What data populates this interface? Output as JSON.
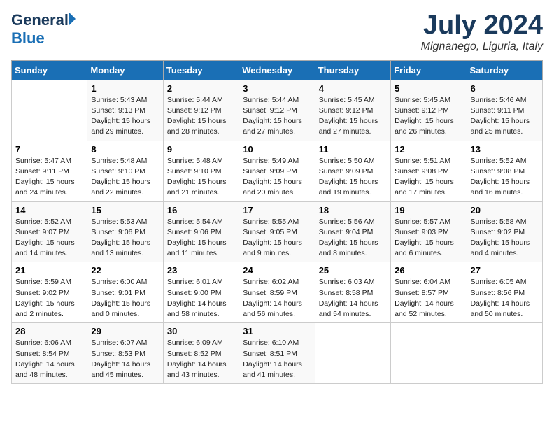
{
  "header": {
    "logo_general": "General",
    "logo_blue": "Blue",
    "month_year": "July 2024",
    "location": "Mignanego, Liguria, Italy"
  },
  "days_of_week": [
    "Sunday",
    "Monday",
    "Tuesday",
    "Wednesday",
    "Thursday",
    "Friday",
    "Saturday"
  ],
  "weeks": [
    [
      {
        "day": "",
        "info": ""
      },
      {
        "day": "1",
        "info": "Sunrise: 5:43 AM\nSunset: 9:13 PM\nDaylight: 15 hours\nand 29 minutes."
      },
      {
        "day": "2",
        "info": "Sunrise: 5:44 AM\nSunset: 9:12 PM\nDaylight: 15 hours\nand 28 minutes."
      },
      {
        "day": "3",
        "info": "Sunrise: 5:44 AM\nSunset: 9:12 PM\nDaylight: 15 hours\nand 27 minutes."
      },
      {
        "day": "4",
        "info": "Sunrise: 5:45 AM\nSunset: 9:12 PM\nDaylight: 15 hours\nand 27 minutes."
      },
      {
        "day": "5",
        "info": "Sunrise: 5:45 AM\nSunset: 9:12 PM\nDaylight: 15 hours\nand 26 minutes."
      },
      {
        "day": "6",
        "info": "Sunrise: 5:46 AM\nSunset: 9:11 PM\nDaylight: 15 hours\nand 25 minutes."
      }
    ],
    [
      {
        "day": "7",
        "info": "Sunrise: 5:47 AM\nSunset: 9:11 PM\nDaylight: 15 hours\nand 24 minutes."
      },
      {
        "day": "8",
        "info": "Sunrise: 5:48 AM\nSunset: 9:10 PM\nDaylight: 15 hours\nand 22 minutes."
      },
      {
        "day": "9",
        "info": "Sunrise: 5:48 AM\nSunset: 9:10 PM\nDaylight: 15 hours\nand 21 minutes."
      },
      {
        "day": "10",
        "info": "Sunrise: 5:49 AM\nSunset: 9:09 PM\nDaylight: 15 hours\nand 20 minutes."
      },
      {
        "day": "11",
        "info": "Sunrise: 5:50 AM\nSunset: 9:09 PM\nDaylight: 15 hours\nand 19 minutes."
      },
      {
        "day": "12",
        "info": "Sunrise: 5:51 AM\nSunset: 9:08 PM\nDaylight: 15 hours\nand 17 minutes."
      },
      {
        "day": "13",
        "info": "Sunrise: 5:52 AM\nSunset: 9:08 PM\nDaylight: 15 hours\nand 16 minutes."
      }
    ],
    [
      {
        "day": "14",
        "info": "Sunrise: 5:52 AM\nSunset: 9:07 PM\nDaylight: 15 hours\nand 14 minutes."
      },
      {
        "day": "15",
        "info": "Sunrise: 5:53 AM\nSunset: 9:06 PM\nDaylight: 15 hours\nand 13 minutes."
      },
      {
        "day": "16",
        "info": "Sunrise: 5:54 AM\nSunset: 9:06 PM\nDaylight: 15 hours\nand 11 minutes."
      },
      {
        "day": "17",
        "info": "Sunrise: 5:55 AM\nSunset: 9:05 PM\nDaylight: 15 hours\nand 9 minutes."
      },
      {
        "day": "18",
        "info": "Sunrise: 5:56 AM\nSunset: 9:04 PM\nDaylight: 15 hours\nand 8 minutes."
      },
      {
        "day": "19",
        "info": "Sunrise: 5:57 AM\nSunset: 9:03 PM\nDaylight: 15 hours\nand 6 minutes."
      },
      {
        "day": "20",
        "info": "Sunrise: 5:58 AM\nSunset: 9:02 PM\nDaylight: 15 hours\nand 4 minutes."
      }
    ],
    [
      {
        "day": "21",
        "info": "Sunrise: 5:59 AM\nSunset: 9:02 PM\nDaylight: 15 hours\nand 2 minutes."
      },
      {
        "day": "22",
        "info": "Sunrise: 6:00 AM\nSunset: 9:01 PM\nDaylight: 15 hours\nand 0 minutes."
      },
      {
        "day": "23",
        "info": "Sunrise: 6:01 AM\nSunset: 9:00 PM\nDaylight: 14 hours\nand 58 minutes."
      },
      {
        "day": "24",
        "info": "Sunrise: 6:02 AM\nSunset: 8:59 PM\nDaylight: 14 hours\nand 56 minutes."
      },
      {
        "day": "25",
        "info": "Sunrise: 6:03 AM\nSunset: 8:58 PM\nDaylight: 14 hours\nand 54 minutes."
      },
      {
        "day": "26",
        "info": "Sunrise: 6:04 AM\nSunset: 8:57 PM\nDaylight: 14 hours\nand 52 minutes."
      },
      {
        "day": "27",
        "info": "Sunrise: 6:05 AM\nSunset: 8:56 PM\nDaylight: 14 hours\nand 50 minutes."
      }
    ],
    [
      {
        "day": "28",
        "info": "Sunrise: 6:06 AM\nSunset: 8:54 PM\nDaylight: 14 hours\nand 48 minutes."
      },
      {
        "day": "29",
        "info": "Sunrise: 6:07 AM\nSunset: 8:53 PM\nDaylight: 14 hours\nand 45 minutes."
      },
      {
        "day": "30",
        "info": "Sunrise: 6:09 AM\nSunset: 8:52 PM\nDaylight: 14 hours\nand 43 minutes."
      },
      {
        "day": "31",
        "info": "Sunrise: 6:10 AM\nSunset: 8:51 PM\nDaylight: 14 hours\nand 41 minutes."
      },
      {
        "day": "",
        "info": ""
      },
      {
        "day": "",
        "info": ""
      },
      {
        "day": "",
        "info": ""
      }
    ]
  ]
}
